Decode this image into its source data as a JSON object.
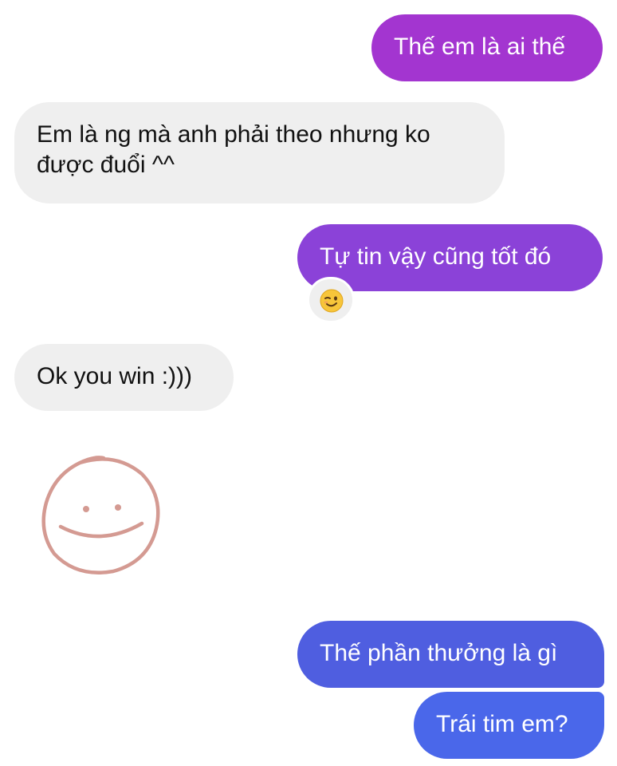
{
  "colors": {
    "sent_purple": "#a335d0",
    "sent_violet": "#8b42d8",
    "sent_blue": "#4f5ee0",
    "received_bg": "#efefef",
    "sticker_stroke": "#d49a92"
  },
  "messages": [
    {
      "side": "sent",
      "text": "Thế em là ai thế"
    },
    {
      "side": "received",
      "text": "Em là ng mà anh phải theo nhưng ko được đuổi ^^"
    },
    {
      "side": "sent",
      "text": "Tự tin vậy cũng tốt đó",
      "reaction": "😉"
    },
    {
      "side": "received",
      "text": "Ok you win :)))"
    },
    {
      "side": "received",
      "sticker": "hand-drawn-smiley-icon"
    },
    {
      "side": "sent",
      "text": "Thế phần thưởng là gì"
    },
    {
      "side": "sent",
      "text": "Trái tim em?"
    }
  ]
}
